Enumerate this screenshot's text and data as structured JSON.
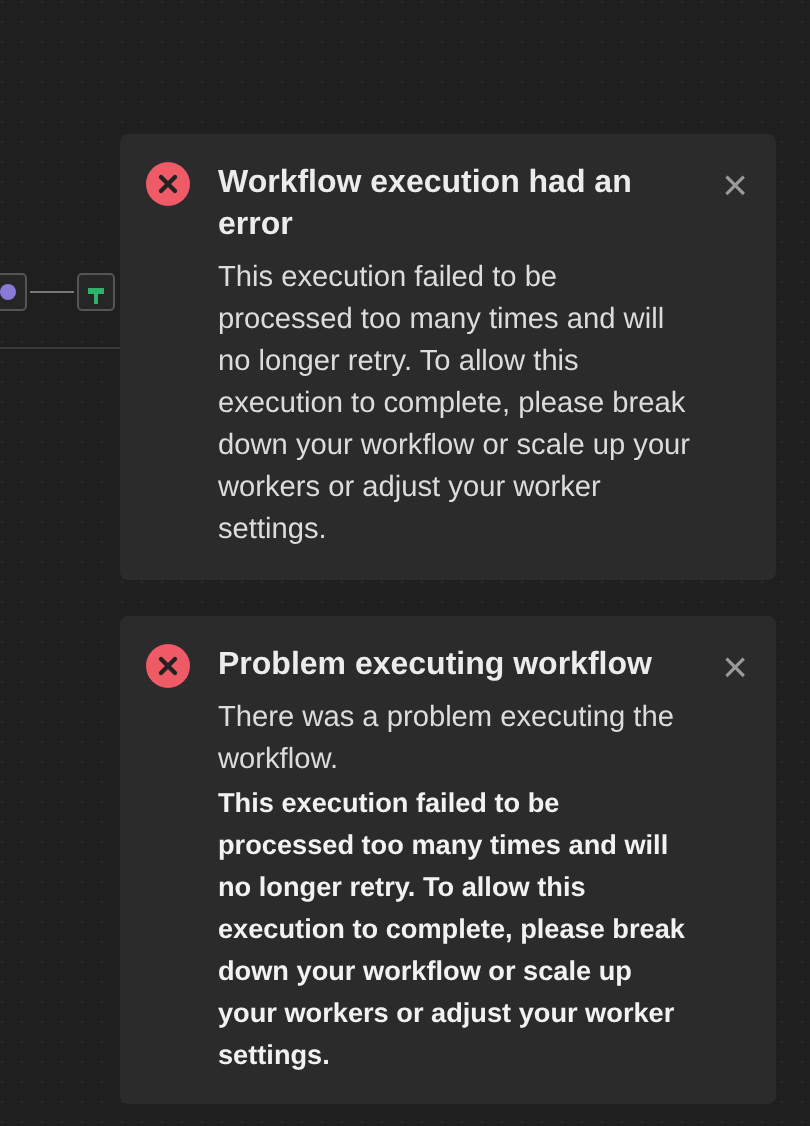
{
  "canvas": {
    "kind": "workflow"
  },
  "toasts": [
    {
      "title": "Workflow execution had an error",
      "close": "×",
      "paragraphs": [
        {
          "text": "This execution failed to be processed too many times and will no longer retry. To allow this execution to complete, please break down your workflow or scale up your workers or adjust your worker settings.",
          "bold": false
        }
      ]
    },
    {
      "title": "Problem executing workflow",
      "close": "×",
      "paragraphs": [
        {
          "text": "There was a problem executing the workflow.",
          "bold": false
        },
        {
          "text": "This execution failed to be processed too many times and will no longer retry. To allow this execution to complete, please break down your workflow or scale up your workers or adjust your worker settings.",
          "bold": true
        }
      ]
    }
  ]
}
